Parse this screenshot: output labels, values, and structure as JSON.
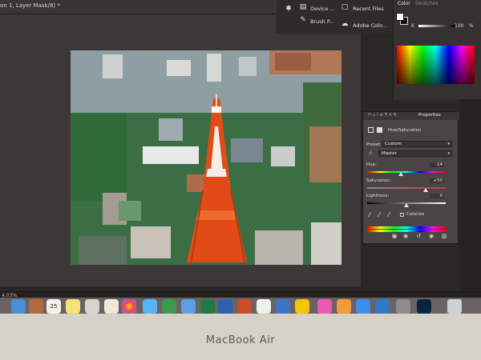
{
  "window": {
    "doc_tab_title": "on 1, Layer Mask/8) *"
  },
  "top_panels": {
    "device_label": "Device ...",
    "brush_label": "Brush P...",
    "recent_files": "Recent Files",
    "adobe_color": "Adobe Colo..."
  },
  "color_panel": {
    "tab_color": "Color",
    "tab_swatches": "Swatches",
    "k_label": "K",
    "k_value": "100",
    "k_unit": "%"
  },
  "properties": {
    "tab_title": "Properties",
    "adjustment": "Hue/Saturation",
    "preset_label": "Preset:",
    "preset_value": "Custom",
    "channel_value": "Master",
    "hue_label": "Hue:",
    "hue_value": "-14",
    "saturation_label": "Saturation:",
    "saturation_value": "+50",
    "lightness_label": "Lightness:",
    "lightness_value": "0",
    "colorize_label": "Colorize"
  },
  "status": {
    "zoom": "4.03%"
  },
  "dock": {
    "calendar_day": "25"
  },
  "laptop": {
    "model": "MacBook Air"
  },
  "colors": {
    "accent": "#ff4a1a",
    "panel_bg": "#4a4544"
  }
}
